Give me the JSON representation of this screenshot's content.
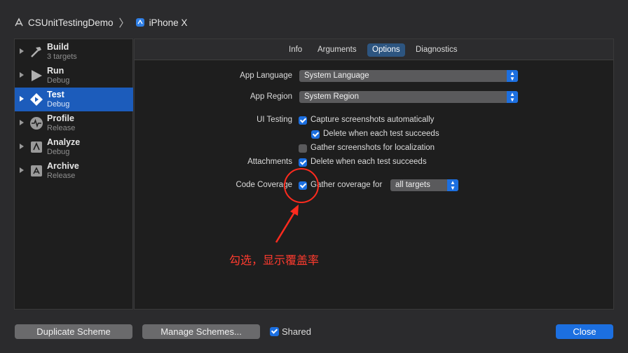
{
  "header": {
    "project": "CSUnitTestingDemo",
    "separator": "〉",
    "device": "iPhone X",
    "project_icon": "xcode-app-icon",
    "device_icon": "simulator-device-icon"
  },
  "sidebar": {
    "items": [
      {
        "title": "Build",
        "subtitle": "3 targets",
        "icon": "hammer-icon"
      },
      {
        "title": "Run",
        "subtitle": "Debug",
        "icon": "play-icon"
      },
      {
        "title": "Test",
        "subtitle": "Debug",
        "icon": "test-diamond-icon"
      },
      {
        "title": "Profile",
        "subtitle": "Release",
        "icon": "waveform-icon"
      },
      {
        "title": "Analyze",
        "subtitle": "Debug",
        "icon": "analyze-icon"
      },
      {
        "title": "Archive",
        "subtitle": "Release",
        "icon": "archive-icon"
      }
    ]
  },
  "tabs": [
    "Info",
    "Arguments",
    "Options",
    "Diagnostics"
  ],
  "active_tab": "Options",
  "options": {
    "app_language_label": "App Language",
    "app_language_value": "System Language",
    "app_region_label": "App Region",
    "app_region_value": "System Region",
    "ui_testing_label": "UI Testing",
    "capture_screenshots": "Capture screenshots automatically",
    "delete_when_succeeds": "Delete when each test succeeds",
    "gather_screenshots": "Gather screenshots for localization",
    "attachments_label": "Attachments",
    "attachments_delete": "Delete when each test succeeds",
    "code_coverage_label": "Code Coverage",
    "gather_coverage": "Gather coverage for",
    "coverage_targets": "all targets"
  },
  "checkboxes": {
    "capture_screenshots": true,
    "delete_when_succeeds": true,
    "gather_screenshots": false,
    "attachments_delete": true,
    "gather_coverage": true,
    "shared": true
  },
  "footer": {
    "duplicate": "Duplicate Scheme",
    "manage": "Manage Schemes...",
    "shared": "Shared",
    "close": "Close"
  },
  "annotation": {
    "text": "勾选，显示覆盖率",
    "color": "#ff2b1e"
  },
  "colors": {
    "accent": "#1c6fe0",
    "selection": "#1c5cbb",
    "background": "#2b2b2d"
  }
}
